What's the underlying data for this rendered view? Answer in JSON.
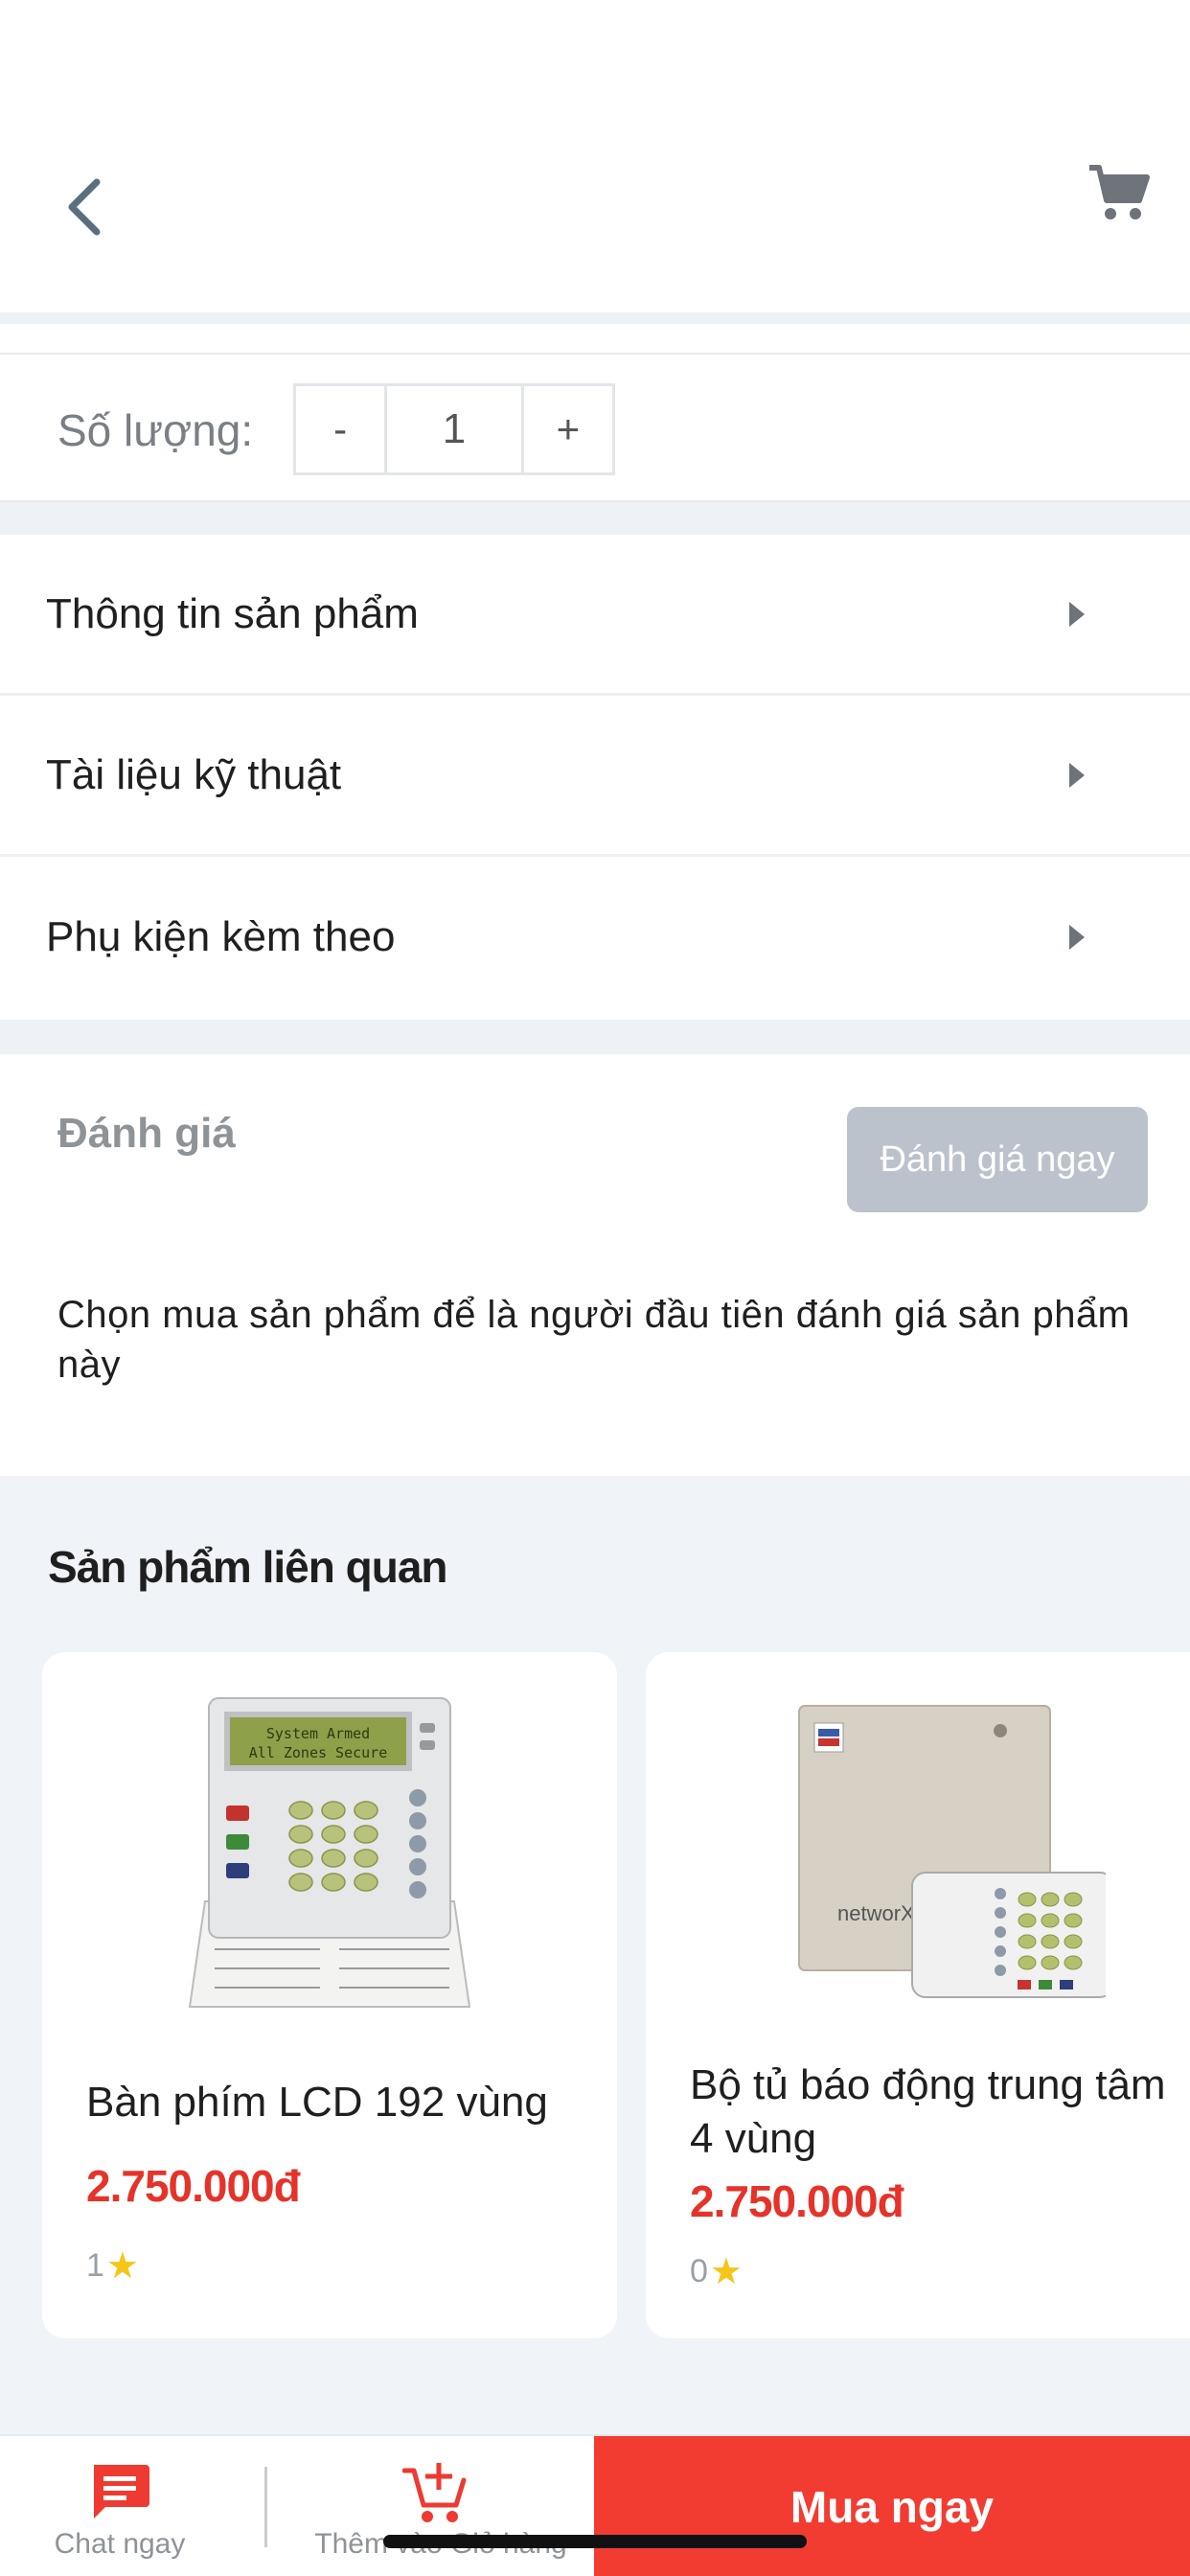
{
  "header": {
    "back_icon": "chevron-left-icon",
    "cart_icon": "cart-icon"
  },
  "quantity": {
    "label": "Số lượng:",
    "minus": "-",
    "value": "1",
    "plus": "+"
  },
  "menu": {
    "items": [
      {
        "label": "Thông tin sản phẩm"
      },
      {
        "label": "Tài liệu kỹ thuật"
      },
      {
        "label": "Phụ kiện kèm theo"
      }
    ]
  },
  "review": {
    "title": "Đánh giá",
    "button": "Đánh giá ngay",
    "empty_text": "Chọn mua sản phẩm để là người đầu tiên đánh giá sản phẩm này"
  },
  "related": {
    "title": "Sản phẩm liên quan",
    "products": [
      {
        "name": "Bàn phím LCD 192 vùng",
        "price": "2.750.000đ",
        "rating": "1"
      },
      {
        "name": "Bộ tủ báo động trung tâm 4 vùng",
        "price": "2.750.000đ",
        "rating": "0"
      }
    ]
  },
  "bottom_bar": {
    "chat_label": "Chat ngay",
    "add_cart_label": "Thêm vào Giỏ hàng",
    "buy_label": "Mua ngay"
  },
  "colors": {
    "accent_red": "#f23c31",
    "price_red": "#e5332a",
    "icon_gray": "#5a6f80",
    "disabled_button": "#bcc2cc",
    "section_bg": "#f0f3f7"
  }
}
